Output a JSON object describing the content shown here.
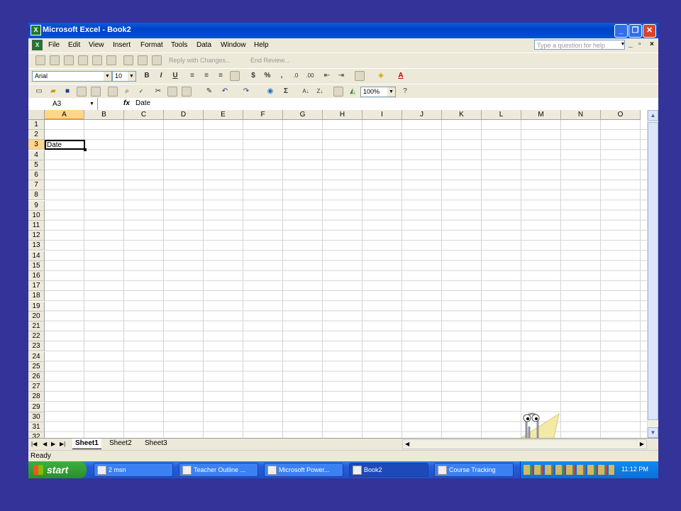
{
  "window": {
    "title": "Microsoft Excel - Book2",
    "app_icon": "X",
    "controls": [
      "_",
      "❐",
      "✕"
    ]
  },
  "menubar": {
    "items": [
      "File",
      "Edit",
      "View",
      "Insert",
      "Format",
      "Tools",
      "Data",
      "Window",
      "Help"
    ],
    "help_placeholder": "Type a question for help",
    "mdi_controls": [
      "_",
      "▫",
      "×"
    ]
  },
  "toolbar_review": {
    "reply_with_changes": "Reply with Changes...",
    "end_review": "End Review..."
  },
  "toolbar_format": {
    "font": "Arial",
    "size": "10",
    "bold": "B",
    "italic": "I",
    "underline": "U",
    "currency": "$",
    "percent": "%",
    "comma": ","
  },
  "toolbar_standard": {
    "zoom": "100%",
    "autosum": "Σ"
  },
  "formula_bar": {
    "name_box": "A3",
    "fx": "fx",
    "formula": "Date"
  },
  "grid": {
    "columns": [
      "A",
      "B",
      "C",
      "D",
      "E",
      "F",
      "G",
      "H",
      "I",
      "J",
      "K",
      "L",
      "M",
      "N",
      "O"
    ],
    "rows": [
      "1",
      "2",
      "3",
      "4",
      "5",
      "6",
      "7",
      "8",
      "9",
      "10",
      "11",
      "12",
      "13",
      "14",
      "15",
      "16",
      "17",
      "18",
      "19",
      "20",
      "21",
      "22",
      "23",
      "24",
      "25",
      "26",
      "27",
      "28",
      "29",
      "30",
      "31",
      "32"
    ],
    "active_cell_value": "Date"
  },
  "sheet_tabs": [
    "Sheet1",
    "Sheet2",
    "Sheet3"
  ],
  "status": "Ready",
  "taskbar": {
    "start": "start",
    "tasks": [
      "2 msn",
      "Teacher Outline ...",
      "Microsoft Power...",
      "Book2",
      "Course Tracking"
    ],
    "clock": "11:12 PM"
  },
  "colors": {
    "background": "#333399",
    "title_bar": "#0A5FD8",
    "taskbar": "#245EDB",
    "start_button": "#3FAF3F",
    "selected_header": "#FFD58A"
  }
}
